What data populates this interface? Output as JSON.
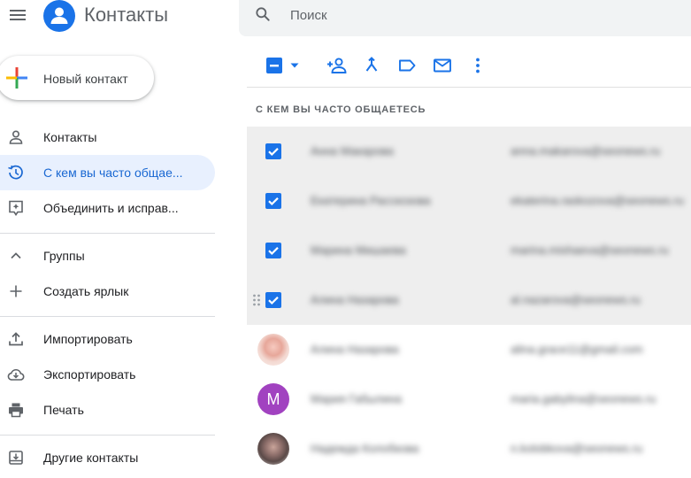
{
  "header": {
    "app_title": "Контакты",
    "menu_icon": "hamburger-menu-icon",
    "logo_icon": "contacts-person-icon",
    "search": {
      "placeholder": "Поиск",
      "value": ""
    }
  },
  "new_contact": {
    "label": "Новый контакт",
    "icon": "multicolor-plus-icon"
  },
  "sidebar": {
    "items": [
      {
        "label": "Контакты",
        "icon": "person-icon",
        "active": false
      },
      {
        "label": "С кем вы часто общае...",
        "icon": "history-icon",
        "active": true
      },
      {
        "label": "Объединить и исправ...",
        "icon": "merge-fix-icon",
        "active": false
      },
      {
        "label": "Группы",
        "icon": "chevron-up-icon",
        "active": false
      },
      {
        "label": "Создать ярлык",
        "icon": "plus-icon",
        "active": false
      },
      {
        "label": "Импортировать",
        "icon": "upload-icon",
        "active": false
      },
      {
        "label": "Экспортировать",
        "icon": "cloud-download-icon",
        "active": false
      },
      {
        "label": "Печать",
        "icon": "printer-icon",
        "active": false
      },
      {
        "label": "Другие контакты",
        "icon": "archive-download-icon",
        "active": false
      }
    ]
  },
  "toolbar": {
    "icons": [
      "select-checkbox-icon",
      "dropdown-arrow-icon",
      "add-to-contacts-icon",
      "merge-icon",
      "label-icon",
      "email-icon",
      "more-vert-icon"
    ]
  },
  "list": {
    "section_title": "С КЕМ ВЫ ЧАСТО ОБЩАЕТЕСЬ",
    "rows": [
      {
        "name": "Анна Макарова",
        "email": "anna.makarova@seonews.ru",
        "selected": true
      },
      {
        "name": "Екатерина Расскозова",
        "email": "ekaterina.raskozova@seonews.ru",
        "selected": true
      },
      {
        "name": "Марина Мишаева",
        "email": "marina.mishaeva@seonews.ru",
        "selected": true
      },
      {
        "name": "Алина Назарова",
        "email": "al.nazarova@seonews.ru",
        "selected": true
      },
      {
        "name": "Алина Назарова",
        "email": "alina.grace11@gmail.com",
        "selected": false
      },
      {
        "name": "Мария Габылина",
        "email": "maria.gabylina@seonews.ru",
        "selected": false,
        "avatar_letter": "M"
      },
      {
        "name": "Надежда Колобкова",
        "email": "n.kolobkova@seonews.ru",
        "selected": false
      }
    ]
  },
  "colors": {
    "accent": "#1a73e8",
    "active_nav_bg": "#e8f0fe",
    "selected_row_bg": "#eeeeee",
    "avatar_m": "#a142c0"
  }
}
